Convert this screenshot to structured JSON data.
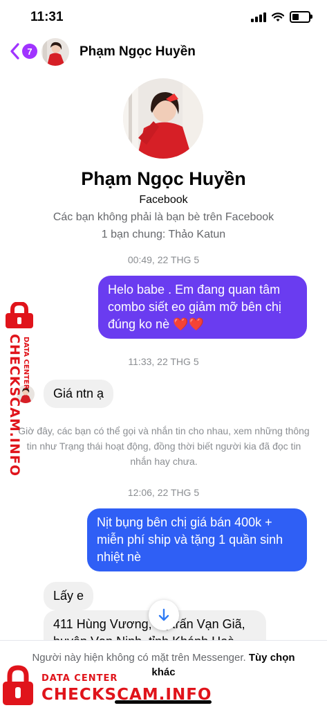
{
  "status_bar": {
    "time": "11:31"
  },
  "header": {
    "back_badge": "7",
    "contact_name": "Phạm Ngọc Huyền"
  },
  "profile": {
    "name": "Phạm Ngọc Huyền",
    "platform": "Facebook",
    "relationship": "Các bạn không phải là bạn bè trên Facebook",
    "mutual": "1 bạn chung: Thảo Katun"
  },
  "messages": {
    "ts1": "00:49, 22 THG 5",
    "m1": "Helo babe . Em đang quan tâm combo siết eo giảm mỡ bên chị đúng ko nè ❤️❤️",
    "ts2": "11:33, 22 THG 5",
    "m2": "Giá ntn ạ",
    "system_note": "Giờ đây, các bạn có thể gọi và nhắn tin cho nhau, xem những thông tin như Trạng thái hoạt động, đồng thời biết người kia đã đọc tin nhắn hay chưa.",
    "ts3": "12:06, 22 THG 5",
    "m3": "Nịt bụng bên chị giá bán 400k + miễn phí ship và tặng 1 quần sinh nhiệt nè",
    "m4": "Lấy e",
    "m5": "411 Hùng Vương, thị trấn Vạn Giã, huyện Vạn Ninh, tỉnh Khánh Hoà"
  },
  "bottom": {
    "notice": "Người này hiện không có mặt trên Messenger.",
    "action": "Tùy chọn khác"
  },
  "watermark": {
    "small": "DATA CENTER",
    "big": "CHECKSCAM.INFO"
  },
  "colors": {
    "outgoing_purple": "#6a3cf0",
    "outgoing_blue": "#2f5ff5",
    "incoming": "#f0f0f0",
    "accent": "#a033ff",
    "watermark": "#e0141b"
  }
}
